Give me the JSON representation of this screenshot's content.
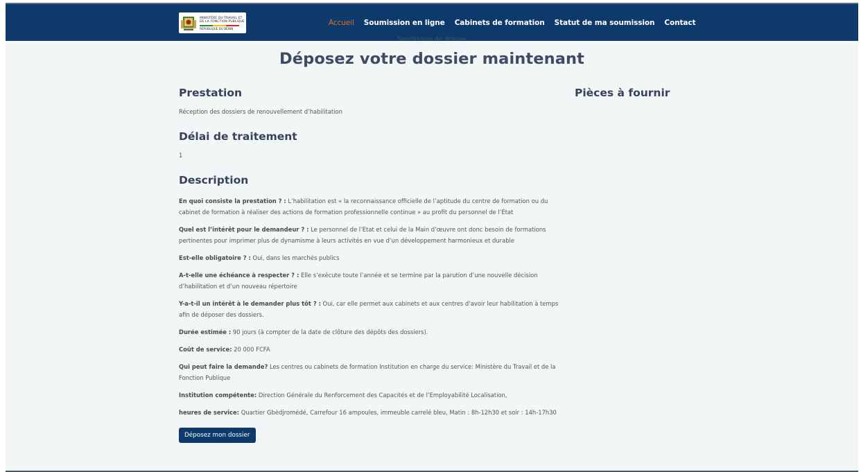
{
  "header": {
    "logo": {
      "line1": "MINISTÈRE DU TRAVAIL ET",
      "line2": "DE LA FONCTION PUBLIQUE",
      "line3": "RÉPUBLIQUE DU BÉNIN",
      "flag_colors": [
        "#1f8a3b",
        "#f2c40f",
        "#d6262b"
      ]
    },
    "nav": [
      {
        "label": "Accueil",
        "active": true
      },
      {
        "label": "Soumission en ligne"
      },
      {
        "label": "Cabinets de formation"
      },
      {
        "label": "Statut de ma soumission"
      },
      {
        "label": "Contact"
      }
    ]
  },
  "breadcrumb": "Soumission de dossier",
  "title": "Déposez votre dossier maintenant",
  "prestation": {
    "heading": "Prestation",
    "text": "Réception des dossiers de renouvellement d’habilitation"
  },
  "delai": {
    "heading": "Délai de traitement",
    "value": "1"
  },
  "pieces": {
    "heading": "Pièces à fournir"
  },
  "description": {
    "heading": "Description",
    "items": [
      {
        "label": "En quoi consiste la prestation ? :",
        "text": " L’habilitation est « la reconnaissance officielle de l’aptitude du centre de formation ou du cabinet de formation à réaliser des actions de formation professionnelle continue » au profit du personnel de l’État"
      },
      {
        "label": "Quel est l’intérêt pour le demandeur ? :",
        "text": " Le personnel de l’Etat et celui de la Main d’œuvre ont donc besoin de formations pertinentes pour imprimer plus de dynamisme à leurs activités en vue d’un développement harmonieux et durable"
      },
      {
        "label": "Est-elle obligatoire ? :",
        "text": " Oui, dans les marchés publics"
      },
      {
        "label": "A-t-elle une échéance à respecter ? :",
        "text": " Elle s’exécute toute l’année et se termine par la parution d’une nouvelle décision d’habilitation et d’un nouveau répertoire"
      },
      {
        "label": "Y-a-t-il un intérêt à le demander plus tôt ? :",
        "text": " Oui, car elle permet aux cabinets et aux centres d’avoir leur habilitation à temps afin de déposer des dossiers."
      },
      {
        "label": "Durée estimée :",
        "text": " 90 jours (à compter de la date de clôture des dépôts des dossiers)."
      },
      {
        "label": "Coût de service:",
        "text": " 20 000 FCFA"
      },
      {
        "label": "Qui peut faire la demande?",
        "text": " Les centres ou cabinets de formation Institution en charge du service: Ministère du Travail et de la Fonction Publique"
      },
      {
        "label": "Institution compétente:",
        "text": " Direction Générale du Renforcement des Capacités et de l’Employabilité Localisation,"
      },
      {
        "label": "heures de service:",
        "text": " Quartier Gbèdjromédé, Carrefour 16 ampoules, immeuble carrelé bleu, Matin : 8h-12h30 et soir : 14h-17h30"
      }
    ]
  },
  "submit_button": "Déposez mon dossier"
}
